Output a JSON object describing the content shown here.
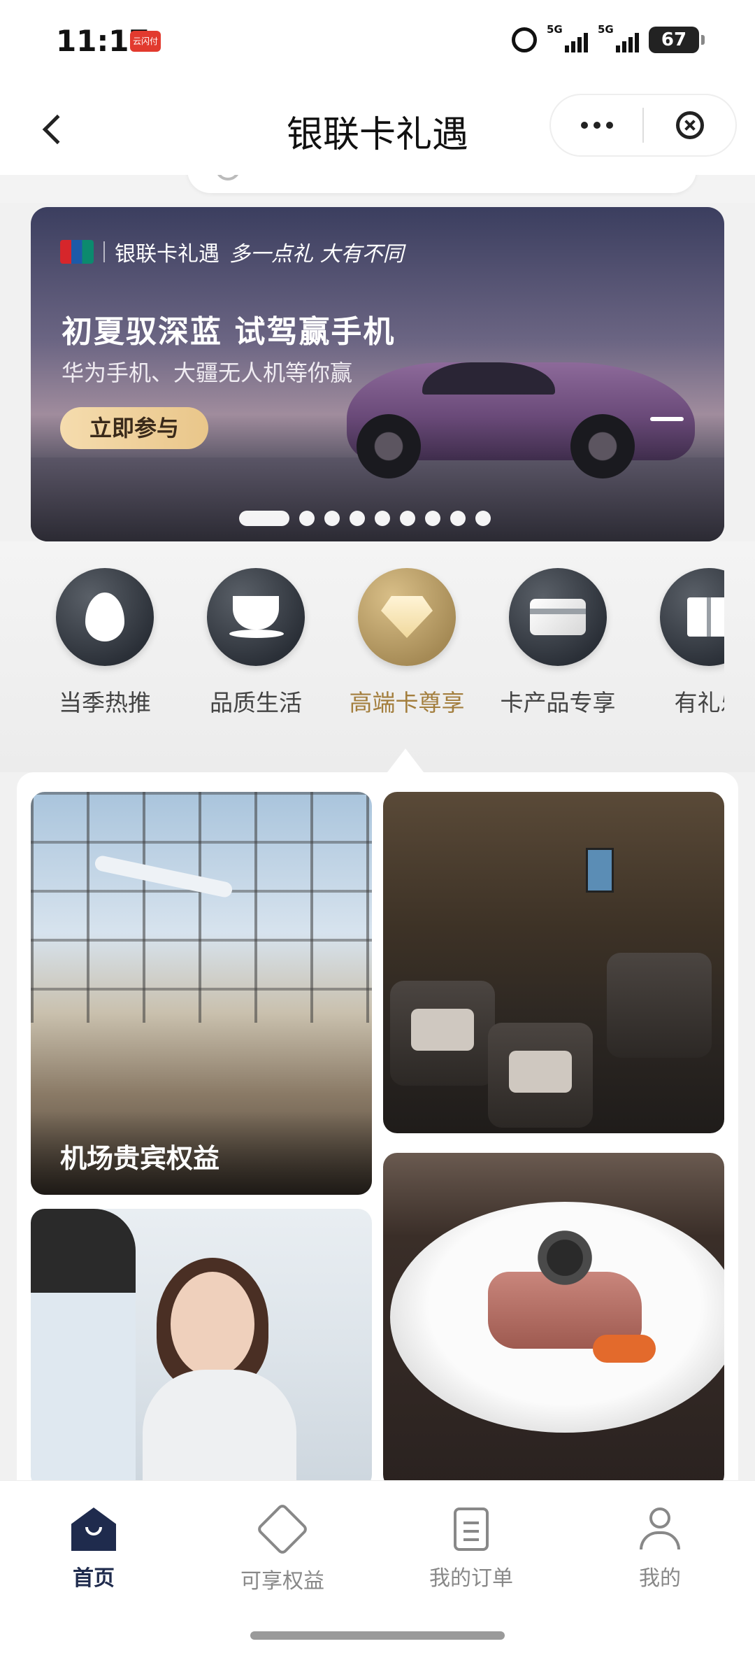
{
  "status_bar": {
    "time": "11:17",
    "app_badge": "云闪付",
    "signal_1": "5G",
    "signal_2": "5G",
    "battery": "67"
  },
  "header": {
    "title": "银联卡礼遇"
  },
  "banner": {
    "brand": "银联卡礼遇",
    "slogan": "多一点礼 大有不同",
    "title": "初夏驭深蓝 试驾赢手机",
    "subtitle": "华为手机、大疆无人机等你赢",
    "cta": "立即参与",
    "page_count": 9,
    "active_page": 1
  },
  "categories": [
    {
      "label": "当季热推",
      "icon": "fire-icon",
      "active": false
    },
    {
      "label": "品质生活",
      "icon": "coffee-cup-icon",
      "active": false
    },
    {
      "label": "高端卡尊享",
      "icon": "diamond-icon",
      "active": true
    },
    {
      "label": "卡产品专享",
      "icon": "credit-card-icon",
      "active": false
    },
    {
      "label": "有礼乐",
      "icon": "gift-icon",
      "active": false
    }
  ],
  "tiles": {
    "airport": {
      "caption": "机场贵宾权益"
    }
  },
  "bottom_nav": [
    {
      "label": "首页",
      "icon": "home-icon",
      "active": true
    },
    {
      "label": "可享权益",
      "icon": "benefits-badge-icon",
      "active": false
    },
    {
      "label": "我的订单",
      "icon": "orders-clipboard-icon",
      "active": false
    },
    {
      "label": "我的",
      "icon": "user-icon",
      "active": false
    }
  ],
  "colors": {
    "nav_active": "#1f2b4d",
    "category_active": "#a37e3d",
    "cta_gold": "#e9c68a"
  }
}
